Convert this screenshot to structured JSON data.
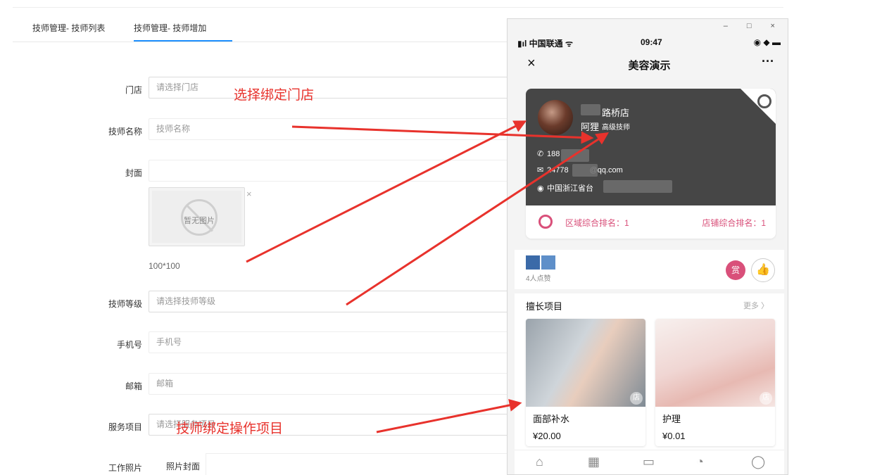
{
  "tabs": [
    {
      "label": "技师管理- 技师列表"
    },
    {
      "label": "技师管理- 技师增加"
    }
  ],
  "form": {
    "store_label": "门店",
    "store_placeholder": "请选择门店",
    "name_label": "技师名称",
    "name_placeholder": "技师名称",
    "cover_label": "封面",
    "no_image_text": "暂无图片",
    "image_close": "×",
    "size_hint": "100*100",
    "level_label": "技师等级",
    "level_placeholder": "请选择技师等级",
    "phone_label": "手机号",
    "phone_placeholder": "手机号",
    "email_label": "邮箱",
    "email_placeholder": "邮箱",
    "service_label": "服务项目",
    "service_placeholder": "请选择服务项目",
    "photos_label": "工作照片",
    "photo_cover_label": "照片封面"
  },
  "annotations": {
    "store": "选择绑定门店",
    "service": "技师绑定操作项目"
  },
  "annotation_color": "#e8322c",
  "window_controls": "– □ ×",
  "phone": {
    "carrier": "▮ıl 中国联通 ᯤ",
    "time": "09:47",
    "status_right": "◉ ◆ ▬",
    "nav_title": "美容演示",
    "nav_close": "×",
    "nav_more": "···",
    "card": {
      "shop_name": "路桥店",
      "tech_name": "阿狸",
      "tech_level": "高级技师",
      "phone": "188",
      "email_prefix": "24778",
      "email_suffix": "@qq.com",
      "address": "中国浙江省台"
    },
    "rank": {
      "region": "区域综合排名：1",
      "store": "店铺综合排名：1"
    },
    "likes_text": "4人点赞",
    "reward_label": "赏",
    "skills_title": "擅长项目",
    "skills_more": "更多 〉",
    "items": [
      {
        "name": "面部补水",
        "price": "¥20.00",
        "tag": "店"
      },
      {
        "name": "护理",
        "price": "¥0.01",
        "tag": "店"
      }
    ],
    "accent_color": "#d9507a"
  }
}
